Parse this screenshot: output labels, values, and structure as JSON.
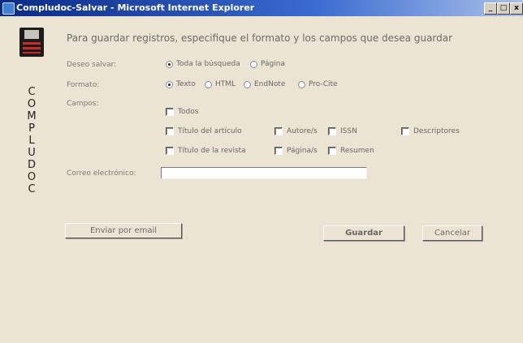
{
  "window": {
    "title": "Compludoc-Salvar - Microsoft Internet Explorer",
    "minimize": "_",
    "maximize": "□",
    "close": "x"
  },
  "logo": {
    "icon": "floppy-disk-icon",
    "letters": [
      "C",
      "O",
      "M",
      "P",
      "L",
      "U",
      "D",
      "O",
      "C"
    ]
  },
  "heading": "Para guardar registros, especifique el formato y los campos que desea guardar",
  "deseo": {
    "label": "Deseo salvar:",
    "options": [
      {
        "label": "Toda la búsqueda",
        "selected": true
      },
      {
        "label": "Página",
        "selected": false
      }
    ]
  },
  "formato": {
    "label": "Formato:",
    "options": [
      {
        "label": "Texto",
        "selected": true
      },
      {
        "label": "HTML",
        "selected": false
      },
      {
        "label": "EndNote",
        "selected": false
      },
      {
        "label": "Pro-Cite",
        "selected": false
      }
    ]
  },
  "campos": {
    "label": "Campos:",
    "items": [
      {
        "label": "Todos",
        "checked": false
      },
      {
        "label": "Título del artículo",
        "checked": false
      },
      {
        "label": "Autore/s",
        "checked": false
      },
      {
        "label": "ISSN",
        "checked": false
      },
      {
        "label": "Descriptores",
        "checked": false
      },
      {
        "label": "Título de la revista",
        "checked": false
      },
      {
        "label": "Página/s",
        "checked": false
      },
      {
        "label": "Resumen",
        "checked": false
      }
    ]
  },
  "email": {
    "label": "Correo electrónico:",
    "value": ""
  },
  "buttons": {
    "send": "Enviar por email",
    "save": "Guardar",
    "cancel": "Cancelar"
  },
  "colors": {
    "background": "#ece4d3",
    "titlebar": "#0a2a86",
    "logo_red": "#cc2a2a"
  }
}
